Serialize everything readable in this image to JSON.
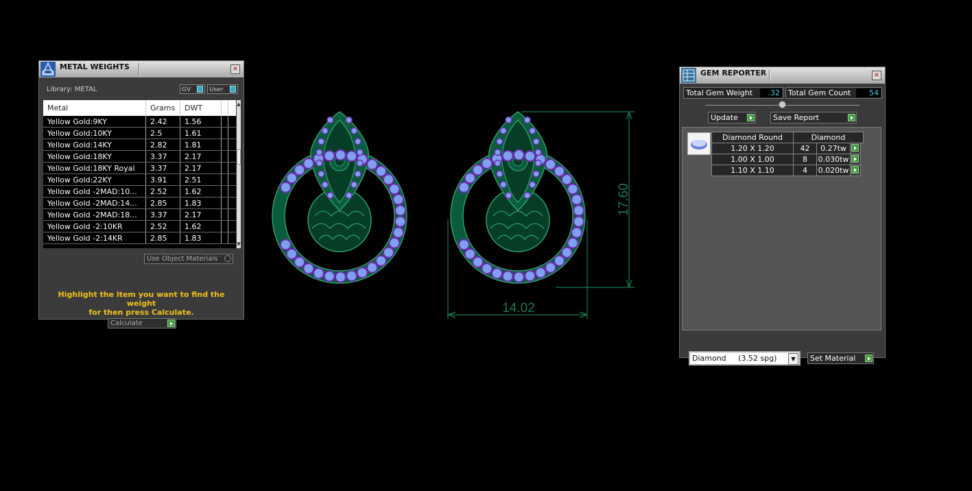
{
  "metal_panel": {
    "title": "METAL WEIGHTS",
    "close": "×",
    "library_label": "Library: METAL",
    "toggle_gv": "GV",
    "toggle_user": "User",
    "columns": [
      "Metal",
      "Grams",
      "DWT"
    ],
    "rows": [
      {
        "metal": "Yellow Gold:9KY",
        "grams": "2.42",
        "dwt": "1.56"
      },
      {
        "metal": "Yellow Gold:10KY",
        "grams": "2.5",
        "dwt": "1.61"
      },
      {
        "metal": "Yellow Gold:14KY",
        "grams": "2.82",
        "dwt": "1.81"
      },
      {
        "metal": "Yellow Gold:18KY",
        "grams": "3.37",
        "dwt": "2.17"
      },
      {
        "metal": "Yellow Gold:18KY Royal",
        "grams": "3.37",
        "dwt": "2.17"
      },
      {
        "metal": "Yellow Gold:22KY",
        "grams": "3.91",
        "dwt": "2.51"
      },
      {
        "metal": "Yellow Gold -2MAD:10...",
        "grams": "2.52",
        "dwt": "1.62"
      },
      {
        "metal": "Yellow Gold -2MAD:14...",
        "grams": "2.85",
        "dwt": "1.83"
      },
      {
        "metal": "Yellow Gold -2MAD:18...",
        "grams": "3.37",
        "dwt": "2.17"
      },
      {
        "metal": "Yellow Gold -2:10KR",
        "grams": "2.52",
        "dwt": "1.62"
      },
      {
        "metal": "Yellow Gold -2:14KR",
        "grams": "2.85",
        "dwt": "1.83"
      }
    ],
    "use_object_materials": "Use Object Materials",
    "hint_line1": "Highlight the item you want to find the weight",
    "hint_line2": "for then press Calculate.",
    "calculate": "Calculate"
  },
  "viewport": {
    "dim_width": "14.02",
    "dim_height": "17.60",
    "metal_color": "#0b5c3c",
    "gem_color": "#7f9ff0",
    "accent_gem_color": "#6a2aa8"
  },
  "gem_panel": {
    "title": "GEM REPORTER",
    "close": "×",
    "total_weight_label": "Total Gem Weight",
    "total_weight_value": ".32",
    "total_count_label": "Total Gem Count",
    "total_count_value": "54",
    "update": "Update",
    "save_report": "Save Report",
    "table_header": [
      "Diamond Round",
      "Diamond"
    ],
    "rows": [
      {
        "size": "1.20 X 1.20",
        "count": "42",
        "weight": "0.27tw"
      },
      {
        "size": "1.00 X 1.00",
        "count": "8",
        "weight": "0.030tw"
      },
      {
        "size": "1.10 X 1.10",
        "count": "4",
        "weight": "0.020tw"
      }
    ],
    "material_select": "Diamond     (3.52 spg)",
    "set_material": "Set Material"
  }
}
